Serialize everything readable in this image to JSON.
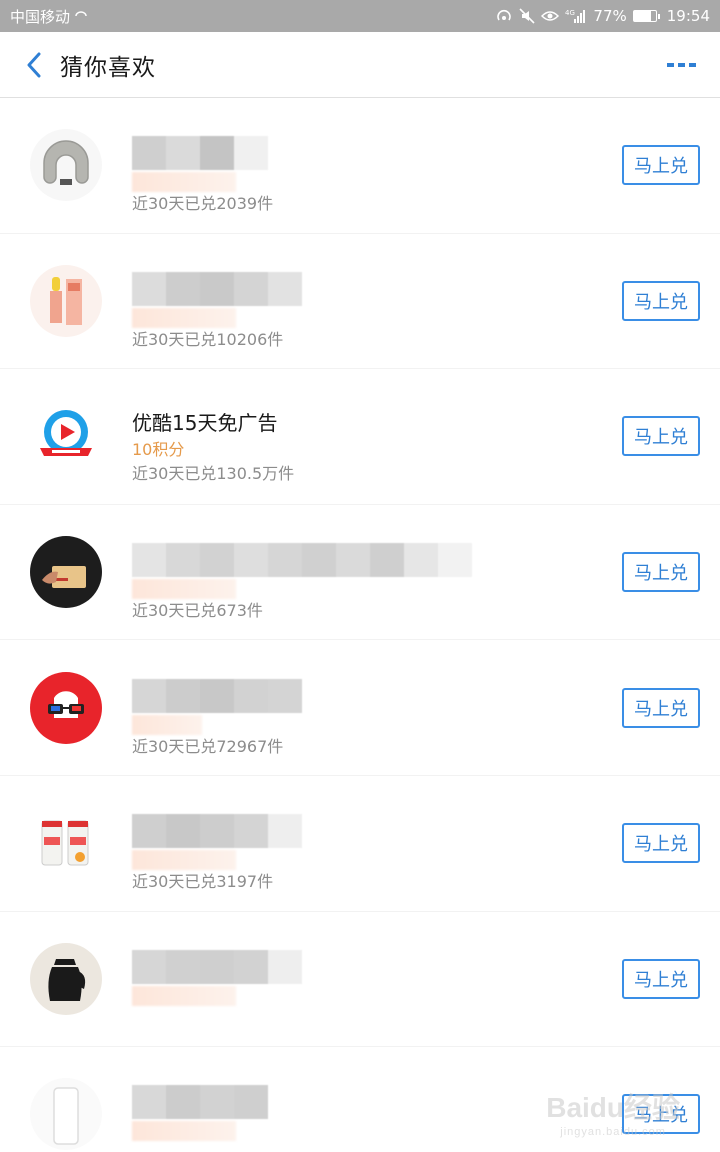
{
  "status_bar": {
    "carrier": "中国移动",
    "battery": "77%",
    "time": "19:54",
    "network": "4G"
  },
  "header": {
    "title": "猜你喜欢",
    "back_icon": "chevron-left-icon",
    "more_icon": "more-dots-icon"
  },
  "colors": {
    "accent": "#3a8ee6",
    "points": "#e59a4b",
    "secondary_text": "#8c8c8c"
  },
  "items": [
    {
      "product": "neck-pillow",
      "title": "",
      "points": "",
      "sales": "近30天已兑2039件",
      "button": "马上兑"
    },
    {
      "product": "lip-balm",
      "title": "",
      "points": "",
      "sales": "近30天已兑10206件",
      "button": "马上兑"
    },
    {
      "product": "youku-logo",
      "title": "优酷15天免广告",
      "points": "10积分",
      "sales": "近30天已兑130.5万件",
      "button": "马上兑"
    },
    {
      "product": "gift-card",
      "title": "",
      "points": "",
      "sales": "近30天已兑673件",
      "button": "马上兑"
    },
    {
      "product": "glasses-logo",
      "title": "",
      "points": "",
      "sales": "近30天已兑72967件",
      "button": "马上兑"
    },
    {
      "product": "vitamin-bottles",
      "title": "",
      "points": "",
      "sales": "近30天已兑3197件",
      "button": "马上兑"
    },
    {
      "product": "thermos-kettle",
      "title": "",
      "points": "",
      "sales": "",
      "button": "马上兑"
    },
    {
      "product": "power-bank",
      "title": "",
      "points": "",
      "sales": "",
      "button": "马上兑"
    }
  ],
  "watermark": {
    "brand": "Baidu经验",
    "url": "jingyan.baidu.com"
  }
}
